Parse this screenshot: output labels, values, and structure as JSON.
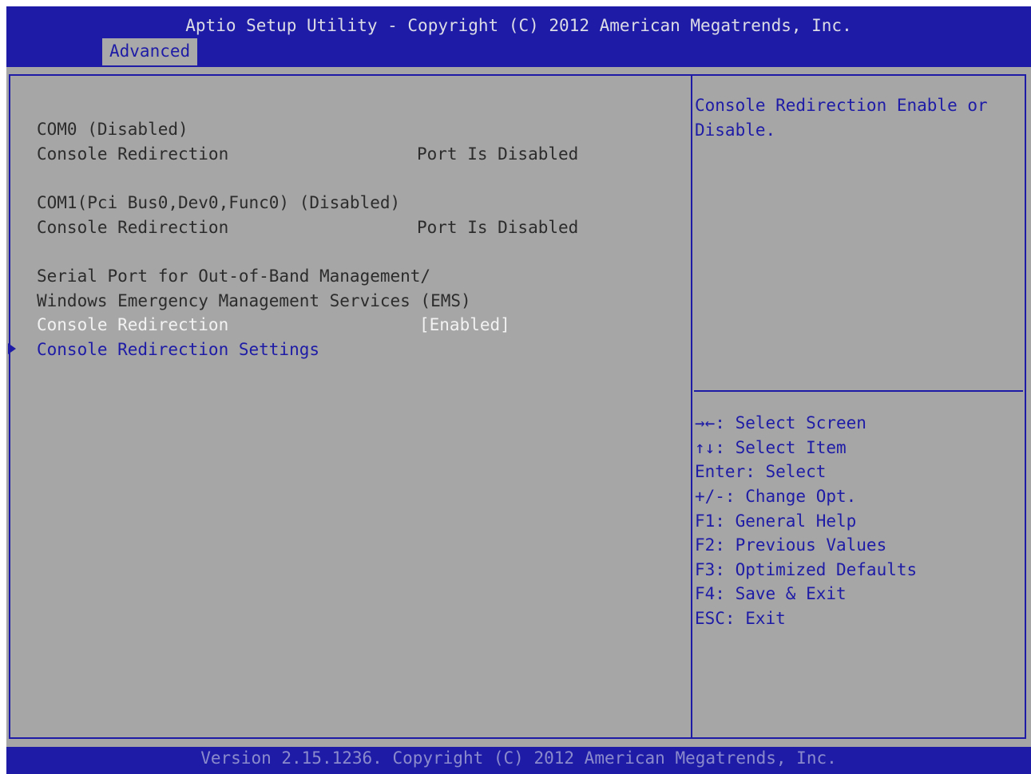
{
  "header": {
    "title": "Aptio Setup Utility - Copyright (C) 2012 American Megatrends, Inc.",
    "active_tab": "Advanced"
  },
  "settings": {
    "com0_title": "COM0 (Disabled)",
    "com0_label": "Console Redirection",
    "com0_value": "Port Is Disabled",
    "com1_title": "COM1(Pci Bus0,Dev0,Func0) (Disabled)",
    "com1_label": "Console Redirection",
    "com1_value": "Port Is Disabled",
    "ems_title_line1": "Serial Port for Out-of-Band Management/",
    "ems_title_line2": "Windows Emergency Management Services (EMS)",
    "ems_label": "Console Redirection",
    "ems_value": "[Enabled]",
    "submenu_label": "Console Redirection Settings"
  },
  "help": {
    "description_line1": "Console Redirection Enable or",
    "description_line2": "Disable.",
    "keys": [
      "→←: Select Screen",
      "↑↓: Select Item",
      "Enter: Select",
      "+/-: Change Opt.",
      "F1: General Help",
      "F2: Previous Values",
      "F3: Optimized Defaults",
      "F4: Save & Exit",
      "ESC: Exit"
    ]
  },
  "footer": {
    "version": "Version 2.15.1236. Copyright (C) 2012 American Megatrends, Inc."
  },
  "colors": {
    "bios_blue": "#1e1ca6",
    "panel_gray": "#a6a6a6",
    "highlight_white": "#f2f2f2"
  },
  "icons": {
    "submenu_arrow": "triangle-right-icon"
  }
}
